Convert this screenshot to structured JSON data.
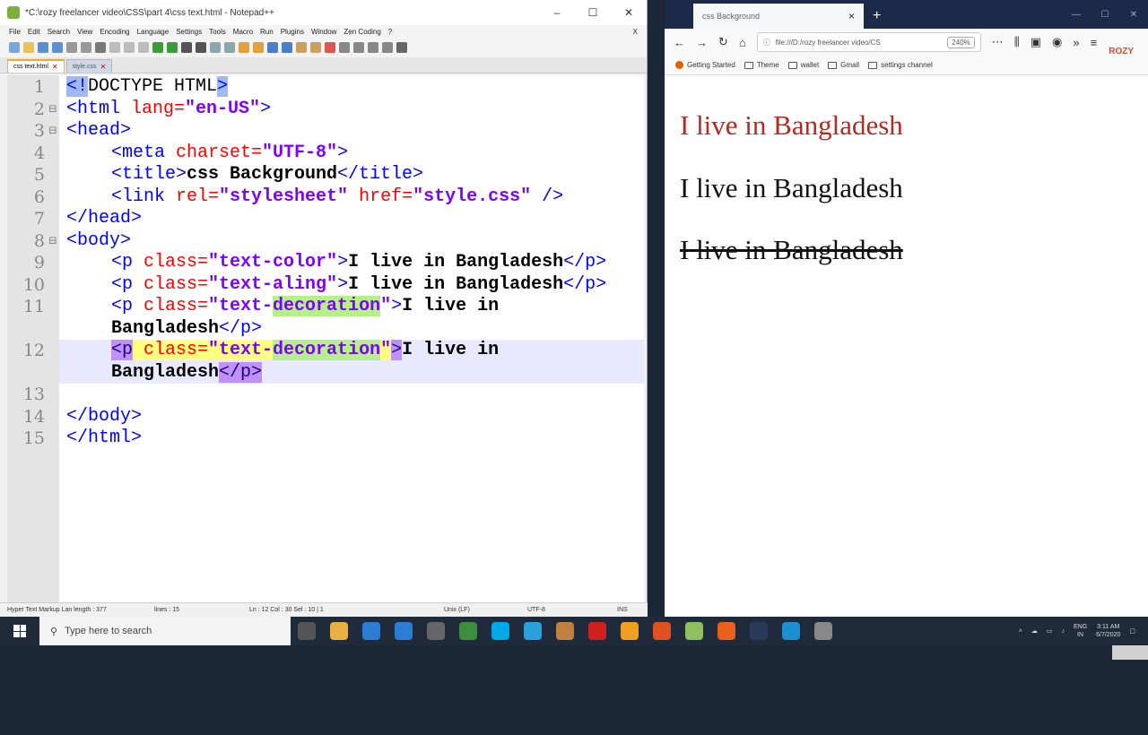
{
  "npp": {
    "title": "*C:\\rozy freelancer video\\CSS\\part 4\\css text.html - Notepad++",
    "menu": [
      "File",
      "Edit",
      "Search",
      "View",
      "Encoding",
      "Language",
      "Settings",
      "Tools",
      "Macro",
      "Run",
      "Plugins",
      "Window",
      "Zen Coding",
      "?"
    ],
    "close_x": "X",
    "tabs": [
      {
        "label": "css text.html",
        "active": true
      },
      {
        "label": "style.css",
        "active": false
      }
    ],
    "line_numbers": [
      "1",
      "2",
      "3",
      "4",
      "5",
      "6",
      "7",
      "8",
      "9",
      "10",
      "11",
      "",
      "12",
      "",
      "13",
      "14",
      "15"
    ],
    "code": {
      "l1a": "<!",
      "l1b": "DOCTYPE HTML",
      "l1c": ">",
      "l2a": "<html ",
      "l2b": "lang=",
      "l2c": "\"en-US\"",
      "l2d": ">",
      "l3": "<head>",
      "l4a": "<meta ",
      "l4b": "charset=",
      "l4c": "\"UTF-8\"",
      "l4d": ">",
      "l5a": "<title>",
      "l5b": "css Background",
      "l5c": "</title>",
      "l6a": "<link ",
      "l6b": "rel=",
      "l6c": "\"stylesheet\"",
      "l6d": " href=",
      "l6e": "\"style.css\"",
      "l6f": " />",
      "l7": "</head>",
      "l8": "<body>",
      "l9a": "<p ",
      "l9b": "class=",
      "l9c": "\"text-color\"",
      "l9d": ">",
      "l9e": "I live in Bangladesh",
      "l9f": "</p>",
      "l10a": "<p ",
      "l10b": "class=",
      "l10c": "\"text-aling\"",
      "l10d": ">",
      "l10e": "I live in Bangladesh",
      "l10f": "</p>",
      "l11a": "<p ",
      "l11b": "class=",
      "l11c": "\"text-",
      "l11d": "decoration",
      "l11e": "\"",
      "l11f": ">",
      "l11g": "I live in",
      "l11h": "Bangladesh",
      "l11i": "</p>",
      "l12a": "<p",
      "l12b": " class=",
      "l12c": "\"text-",
      "l12d": "decoration",
      "l12e": "\"",
      "l12f": ">",
      "l12g": "I live in",
      "l12h": "Bangladesh",
      "l12i": "</p>",
      "l14": "</body>",
      "l15": "</html>"
    },
    "status": {
      "type": "Hyper Text Markup Lan length : 377",
      "lines": "lines : 15",
      "pos": "Ln : 12   Col : 30   Sel : 10 | 1",
      "eol": "Unix (LF)",
      "enc": "UTF-8",
      "ins": "INS"
    }
  },
  "firefox": {
    "tab_title": "css Background",
    "tab_close": "×",
    "new_tab": "+",
    "url": "file:///D:/rozy freelancer video/CS",
    "zoom": "240%",
    "bookmarks": [
      "Getting Started",
      "Theme",
      "wallet",
      "Gmail",
      "settings channel"
    ],
    "logo_text": "ROZY",
    "content": [
      {
        "text": "I live in Bangladesh",
        "style": "color red"
      },
      {
        "text": "I live in Bangladesh",
        "style": "plain"
      },
      {
        "text": "I live in Bangladesh",
        "style": "line-through"
      }
    ]
  },
  "taskbar": {
    "search_placeholder": "Type here to search",
    "lang_top": "ENG",
    "lang_bottom": "IN",
    "time": "3:11 AM",
    "date": "6/7/2020"
  },
  "colors": {
    "tag": "#0000ff",
    "attr": "#ff0000",
    "value": "#8000ff",
    "red_text": "#b22a22"
  }
}
